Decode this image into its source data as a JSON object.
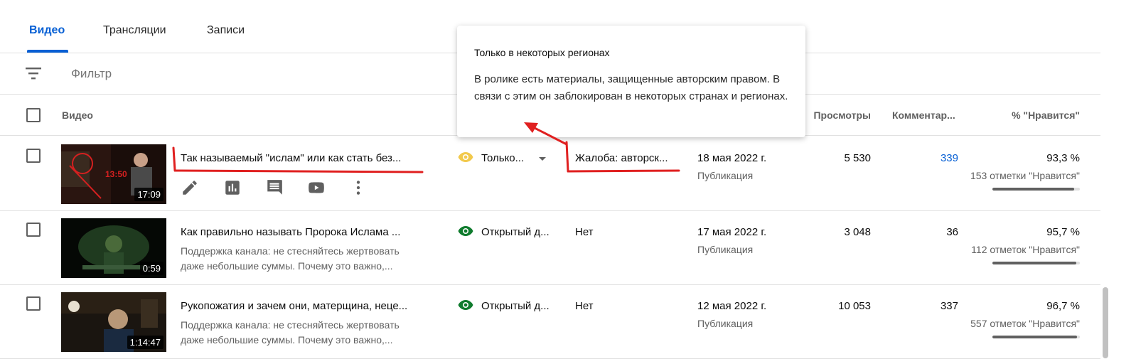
{
  "tabs": [
    {
      "label": "Видео",
      "active": true
    },
    {
      "label": "Трансляции",
      "active": false
    },
    {
      "label": "Записи",
      "active": false
    }
  ],
  "filter": {
    "placeholder": "Фильтр"
  },
  "columns": {
    "video": "Видео",
    "views": "Просмотры",
    "comments": "Комментар...",
    "likes": "% \"Нравится\""
  },
  "tooltip": {
    "title": "Только в некоторых регионах",
    "body": "В ролике есть материалы, защищенные авторским правом. В связи с этим он заблокирован в некоторых странах и регионах."
  },
  "rows": [
    {
      "title": "Так называемый \"ислам\" или как стать без...",
      "description": [],
      "duration": "17:09",
      "visibility": "Только...",
      "visibility_color": "#f2c94c",
      "restrictions": "Жалоба: авторск...",
      "date": "18 мая 2022 г.",
      "date_sub": "Публикация",
      "views": "5 530",
      "comments": "339",
      "likes_pct": "93,3 %",
      "likes_count": "153 отметки \"Нравится\"",
      "likes_fraction": 0.933
    },
    {
      "title": "Как правильно называть Пророка Ислама ...",
      "description": [
        "Поддержка канала: не стесняйтесь жертвовать",
        "даже небольшие суммы. Почему это важно,..."
      ],
      "duration": "0:59",
      "visibility": "Открытый д...",
      "visibility_color": "#0f7b2d",
      "restrictions": "Нет",
      "date": "17 мая 2022 г.",
      "date_sub": "Публикация",
      "views": "3 048",
      "comments": "36",
      "likes_pct": "95,7 %",
      "likes_count": "112 отметок \"Нравится\"",
      "likes_fraction": 0.957
    },
    {
      "title": "Рукопожатия и зачем они, матерщина, неце...",
      "description": [
        "Поддержка канала: не стесняйтесь жертвовать",
        "даже небольшие суммы. Почему это важно,..."
      ],
      "duration": "1:14:47",
      "visibility": "Открытый д...",
      "visibility_color": "#0f7b2d",
      "restrictions": "Нет",
      "date": "12 мая 2022 г.",
      "date_sub": "Публикация",
      "views": "10 053",
      "comments": "337",
      "likes_pct": "96,7 %",
      "likes_count": "557 отметок \"Нравится\"",
      "likes_fraction": 0.967
    }
  ],
  "row_actions": [
    "pencil-icon",
    "analytics-icon",
    "comments-icon",
    "youtube-icon",
    "more-vert-icon"
  ],
  "accent": "#065fd4",
  "annotation_color": "#e02020"
}
